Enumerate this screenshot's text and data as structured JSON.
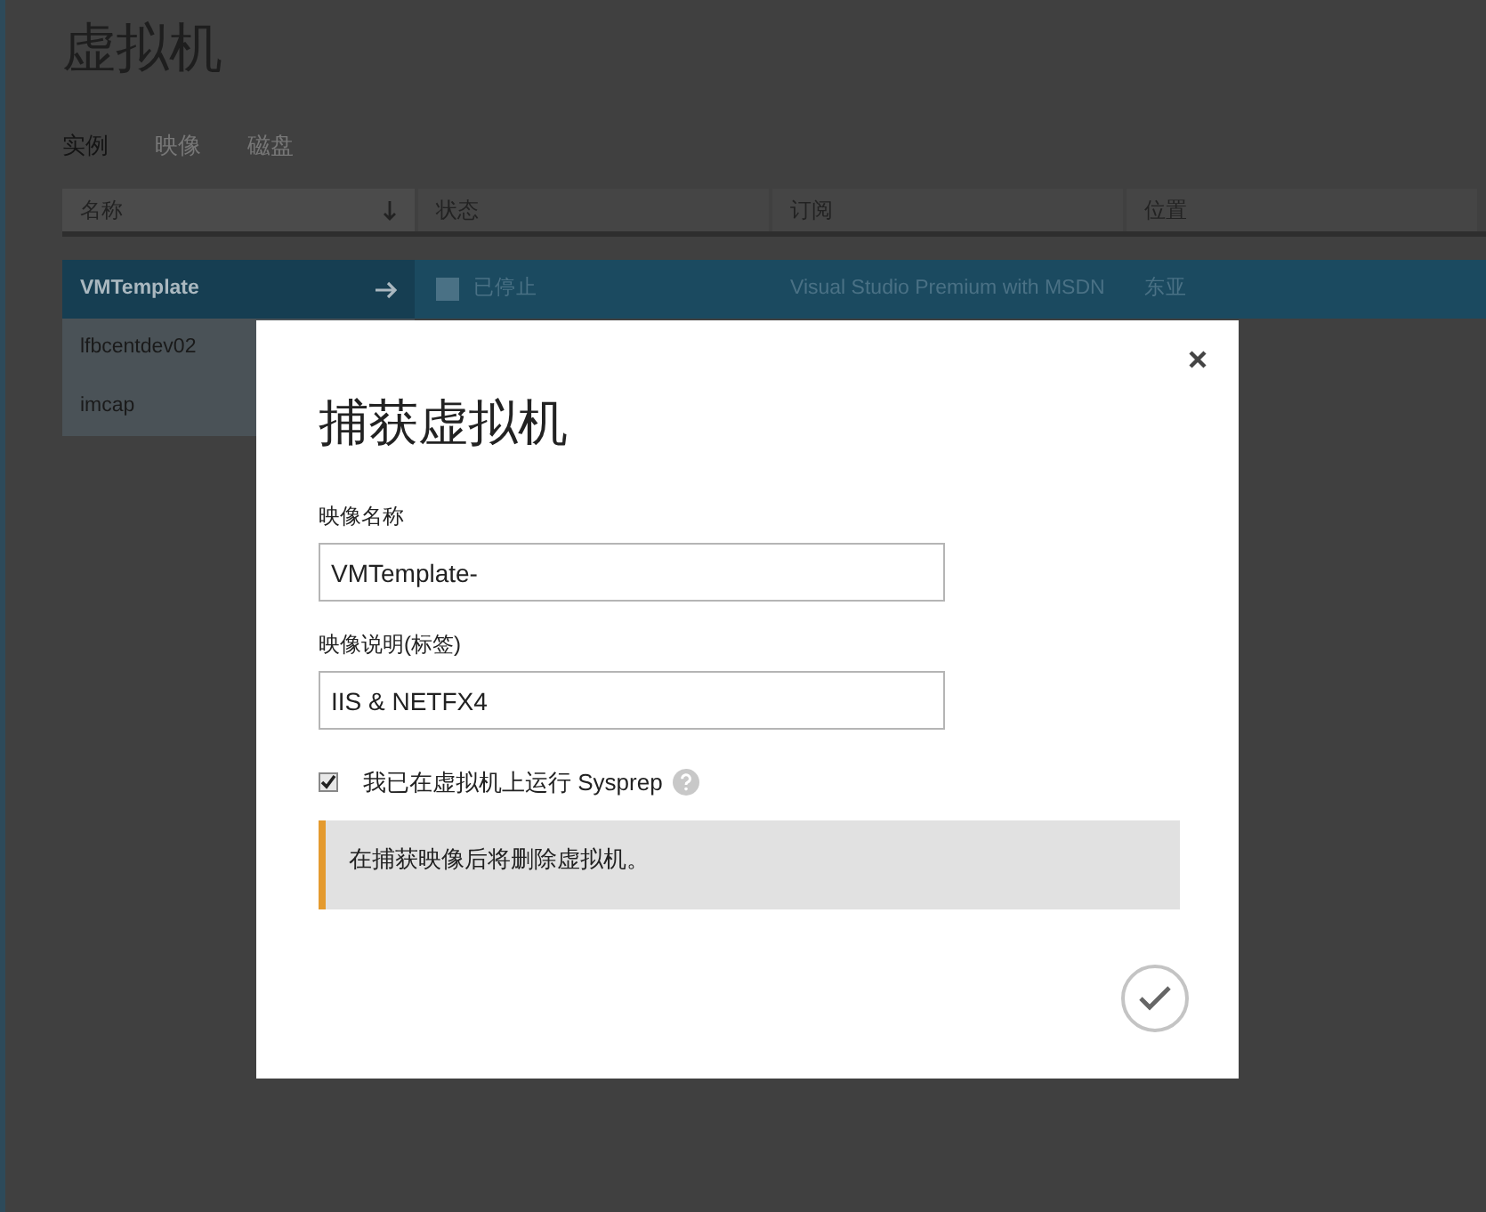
{
  "page": {
    "title": "虚拟机"
  },
  "tabs": [
    {
      "label": "实例",
      "selected": true
    },
    {
      "label": "映像",
      "selected": false
    },
    {
      "label": "磁盘",
      "selected": false
    }
  ],
  "table": {
    "columns": [
      {
        "label": "名称",
        "sorted": true
      },
      {
        "label": "状态",
        "sorted": false
      },
      {
        "label": "订阅",
        "sorted": false
      },
      {
        "label": "位置",
        "sorted": false
      }
    ],
    "rows": [
      {
        "selected": true,
        "cells": [
          "VMTemplate",
          "已停止",
          "Visual Studio Premium with MSDN",
          "东亚"
        ]
      },
      {
        "selected": false,
        "cells": [
          "lfbcentdev02"
        ]
      },
      {
        "selected": false,
        "cells": [
          "imcap"
        ]
      }
    ]
  },
  "dialog": {
    "title": "捕获虚拟机",
    "fields": [
      {
        "label": "映像名称",
        "value": "VMTemplate-"
      },
      {
        "label": "映像说明(标签)",
        "value": "IIS & NETFX4"
      }
    ],
    "checkbox": {
      "label": "我已在虚拟机上运行 Sysprep",
      "checked": true
    },
    "notice": "在捕获映像后将删除虚拟机。"
  }
}
